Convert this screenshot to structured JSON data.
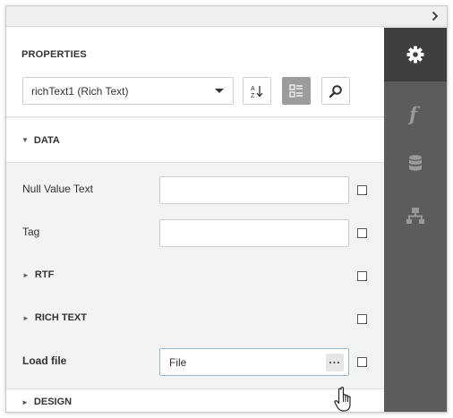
{
  "panel": {
    "title": "PROPERTIES",
    "object_selector": {
      "value": "richText1 (Rich Text)"
    },
    "toolbar": {
      "sort_icon": "sort-alphabetical-icon",
      "categories_icon": "categorized-view-icon",
      "search_icon": "search-icon"
    }
  },
  "groups": {
    "data": {
      "label": "DATA",
      "expanded": true
    },
    "design": {
      "label": "DESIGN",
      "expanded": false
    }
  },
  "fields": {
    "null_value_text": {
      "label": "Null Value Text",
      "value": ""
    },
    "tag": {
      "label": "Tag",
      "value": ""
    },
    "rtf": {
      "label": "RTF"
    },
    "rich_text": {
      "label": "RICH TEXT"
    },
    "load_file": {
      "label": "Load file",
      "value": "File",
      "button": "···"
    }
  },
  "sidebar": {
    "items": [
      {
        "icon": "gear-icon",
        "active": true
      },
      {
        "icon": "function-icon",
        "active": false
      },
      {
        "icon": "database-icon",
        "active": false
      },
      {
        "icon": "hierarchy-icon",
        "active": false
      }
    ]
  },
  "colors": {
    "sidebar_bg": "#5c5c5c",
    "sidebar_active": "#3f3f3f",
    "panel_bg": "#f3f3f3"
  }
}
